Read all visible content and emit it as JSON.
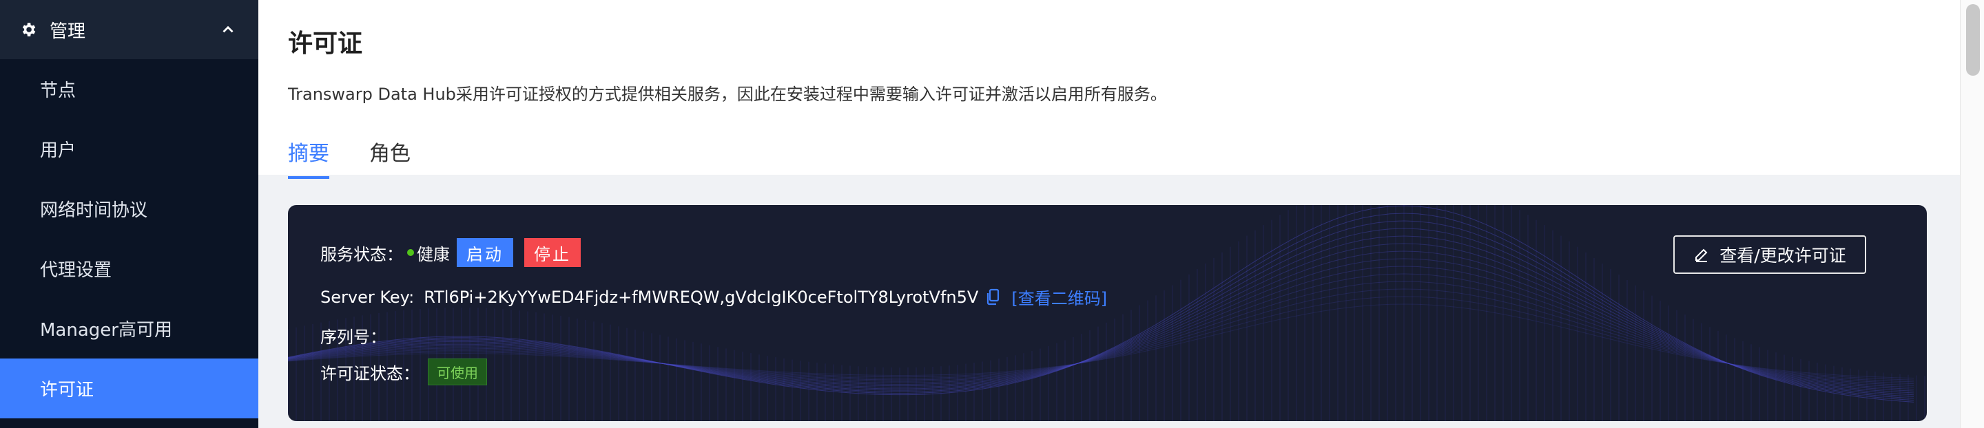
{
  "sidebar": {
    "header": {
      "label": "管理",
      "icon": "gear-icon",
      "expand_icon": "chevron-up-icon"
    },
    "items": [
      {
        "label": "节点"
      },
      {
        "label": "用户"
      },
      {
        "label": "网络时间协议"
      },
      {
        "label": "代理设置"
      },
      {
        "label": "Manager高可用"
      },
      {
        "label": "许可证",
        "active": true
      }
    ]
  },
  "page": {
    "title": "许可证",
    "description": "Transwarp Data Hub采用许可证授权的方式提供相关服务，因此在安装过程中需要输入许可证并激活以启用所有服务。",
    "tabs": [
      {
        "label": "摘要",
        "active": true
      },
      {
        "label": "角色"
      }
    ]
  },
  "card": {
    "service_status_label": "服务状态：",
    "service_status_value": "健康",
    "start_button": "启动",
    "stop_button": "停止",
    "server_key_label": "Server Key:",
    "server_key_value": "RTl6Pi+2KyYYwED4Fjdz+fMWREQW,gVdcIgIK0ceFtolTY8LyrotVfn5V",
    "qr_link": "[查看二维码]",
    "serial_label": "序列号：",
    "serial_value": "",
    "license_status_label": "许可证状态：",
    "license_status_value": "可使用",
    "view_change_button": "查看/更改许可证"
  },
  "colors": {
    "sidebar_bg": "#0b1425",
    "sidebar_header_bg": "#1a2435",
    "accent": "#3d7eff",
    "stop": "#f5484d",
    "healthy": "#52c41a",
    "card_bg": "#181d30"
  }
}
